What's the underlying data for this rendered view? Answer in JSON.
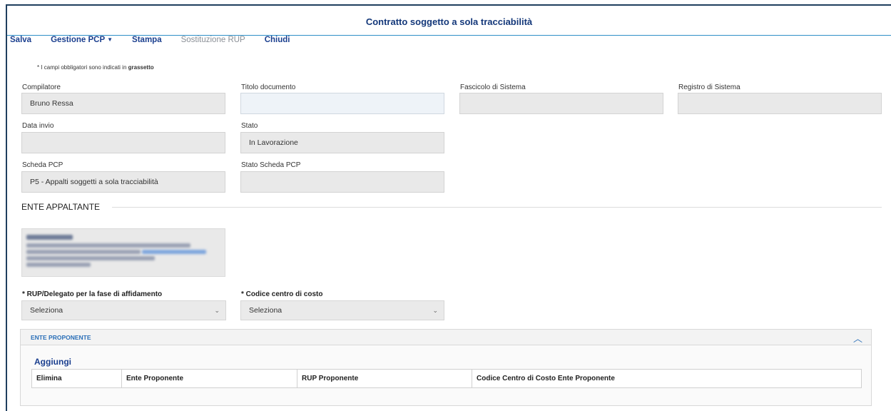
{
  "title": "Contratto soggetto a sola tracciabilità",
  "toolbar": {
    "salva": "Salva",
    "gestione": "Gestione PCP",
    "stampa": "Stampa",
    "sostituzione": "Sostituzione RUP",
    "chiudi": "Chiudi"
  },
  "hint": {
    "text": "* I campi obbligatori sono indicati in ",
    "bold": "grassetto"
  },
  "fields": {
    "compilatore": {
      "label": "Compilatore",
      "value": "Bruno Ressa"
    },
    "titolo": {
      "label": "Titolo documento",
      "value": ""
    },
    "fascicolo": {
      "label": "Fascicolo di Sistema",
      "value": ""
    },
    "registro": {
      "label": "Registro di Sistema",
      "value": ""
    },
    "data_invio": {
      "label": "Data invio",
      "value": ""
    },
    "stato": {
      "label": "Stato",
      "value": "In Lavorazione"
    },
    "scheda": {
      "label": "Scheda PCP",
      "value": "P5 - Appalti soggetti a sola tracciabilità"
    },
    "stato_scheda": {
      "label": "Stato Scheda PCP",
      "value": ""
    }
  },
  "ente_appaltante": {
    "title": "ENTE APPALTANTE"
  },
  "selects": {
    "rup": {
      "label": "* RUP/Delegato per la fase di affidamento",
      "value": "Seleziona"
    },
    "centro": {
      "label": "* Codice centro di costo",
      "value": "Seleziona"
    }
  },
  "ente_proponente": {
    "title": "ENTE PROPONENTE",
    "add": "Aggiungi",
    "columns": [
      "Elimina",
      "Ente Proponente",
      "RUP Proponente",
      "Codice Centro di Costo Ente Proponente"
    ]
  },
  "icons": {
    "collapse": "chevron-up-icon",
    "dropdown": "chevron-down-icon",
    "menu": "caret-down-icon"
  }
}
